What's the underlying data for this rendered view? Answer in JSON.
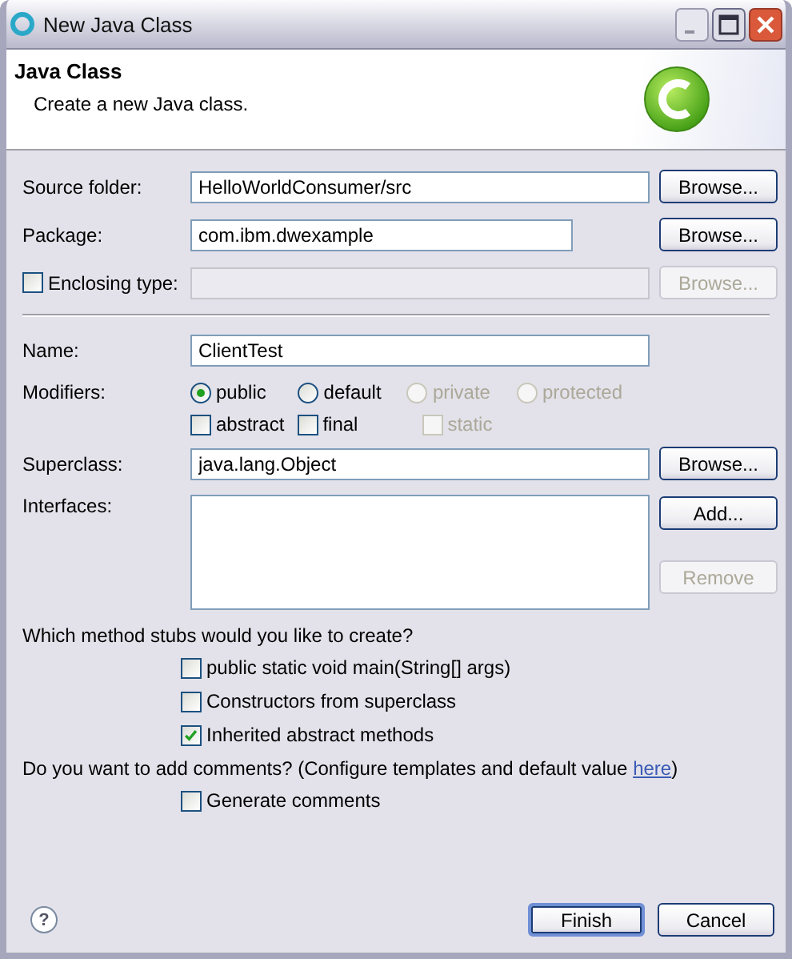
{
  "window": {
    "title": "New Java Class"
  },
  "header": {
    "title": "Java Class",
    "description": "Create a new Java class."
  },
  "location_rows": [
    {
      "kind": "text",
      "label": "Source folder:",
      "value": "HelloWorldConsumer/src",
      "button": {
        "label": "Browse...",
        "disabled": false
      }
    },
    {
      "kind": "short_text",
      "label": "Package:",
      "value": "com.ibm.dwexample",
      "button": {
        "label": "Browse...",
        "disabled": false
      }
    },
    {
      "kind": "check_text",
      "label": "Enclosing type:",
      "checked": false,
      "disabled": true,
      "button": {
        "label": "Browse...",
        "disabled": true
      }
    }
  ],
  "type_rows": [
    {
      "kind": "text",
      "label": "Name:",
      "value": "ClientTest"
    },
    {
      "kind": "radios",
      "label": "Modifiers:",
      "options": [
        {
          "label": "public",
          "selected": true,
          "disabled": false
        },
        {
          "label": "default",
          "selected": false,
          "disabled": false
        },
        {
          "label": "private",
          "selected": false,
          "disabled": true
        },
        {
          "label": "protected",
          "selected": false,
          "disabled": true
        }
      ]
    },
    {
      "kind": "checks",
      "options": [
        {
          "label": "abstract",
          "checked": false,
          "disabled": false
        },
        {
          "label": "final",
          "checked": false,
          "disabled": false
        },
        {
          "label": "static",
          "checked": false,
          "disabled": true
        }
      ]
    },
    {
      "kind": "text",
      "label": "Superclass:",
      "value": "java.lang.Object",
      "button": {
        "label": "Browse...",
        "disabled": false
      }
    },
    {
      "kind": "list",
      "label": "Interfaces:",
      "buttons": [
        {
          "label": "Add...",
          "disabled": false
        },
        {
          "label": "Remove",
          "disabled": true
        }
      ]
    }
  ],
  "stubs": {
    "question": "Which method stubs would you like to create?",
    "options": [
      {
        "label": "public static void main(String[] args)",
        "checked": false
      },
      {
        "label": "Constructors from superclass",
        "checked": false
      },
      {
        "label": "Inherited abstract methods",
        "checked": true
      }
    ]
  },
  "comments": {
    "question": "Do you want to add comments? (Configure templates and default value ",
    "link": "here",
    "question_end": ")",
    "options": [
      {
        "label": "Generate comments",
        "checked": false
      }
    ]
  },
  "footer": {
    "help": "?",
    "buttons": [
      {
        "label": "Finish",
        "default": true
      },
      {
        "label": "Cancel",
        "default": false
      }
    ]
  }
}
